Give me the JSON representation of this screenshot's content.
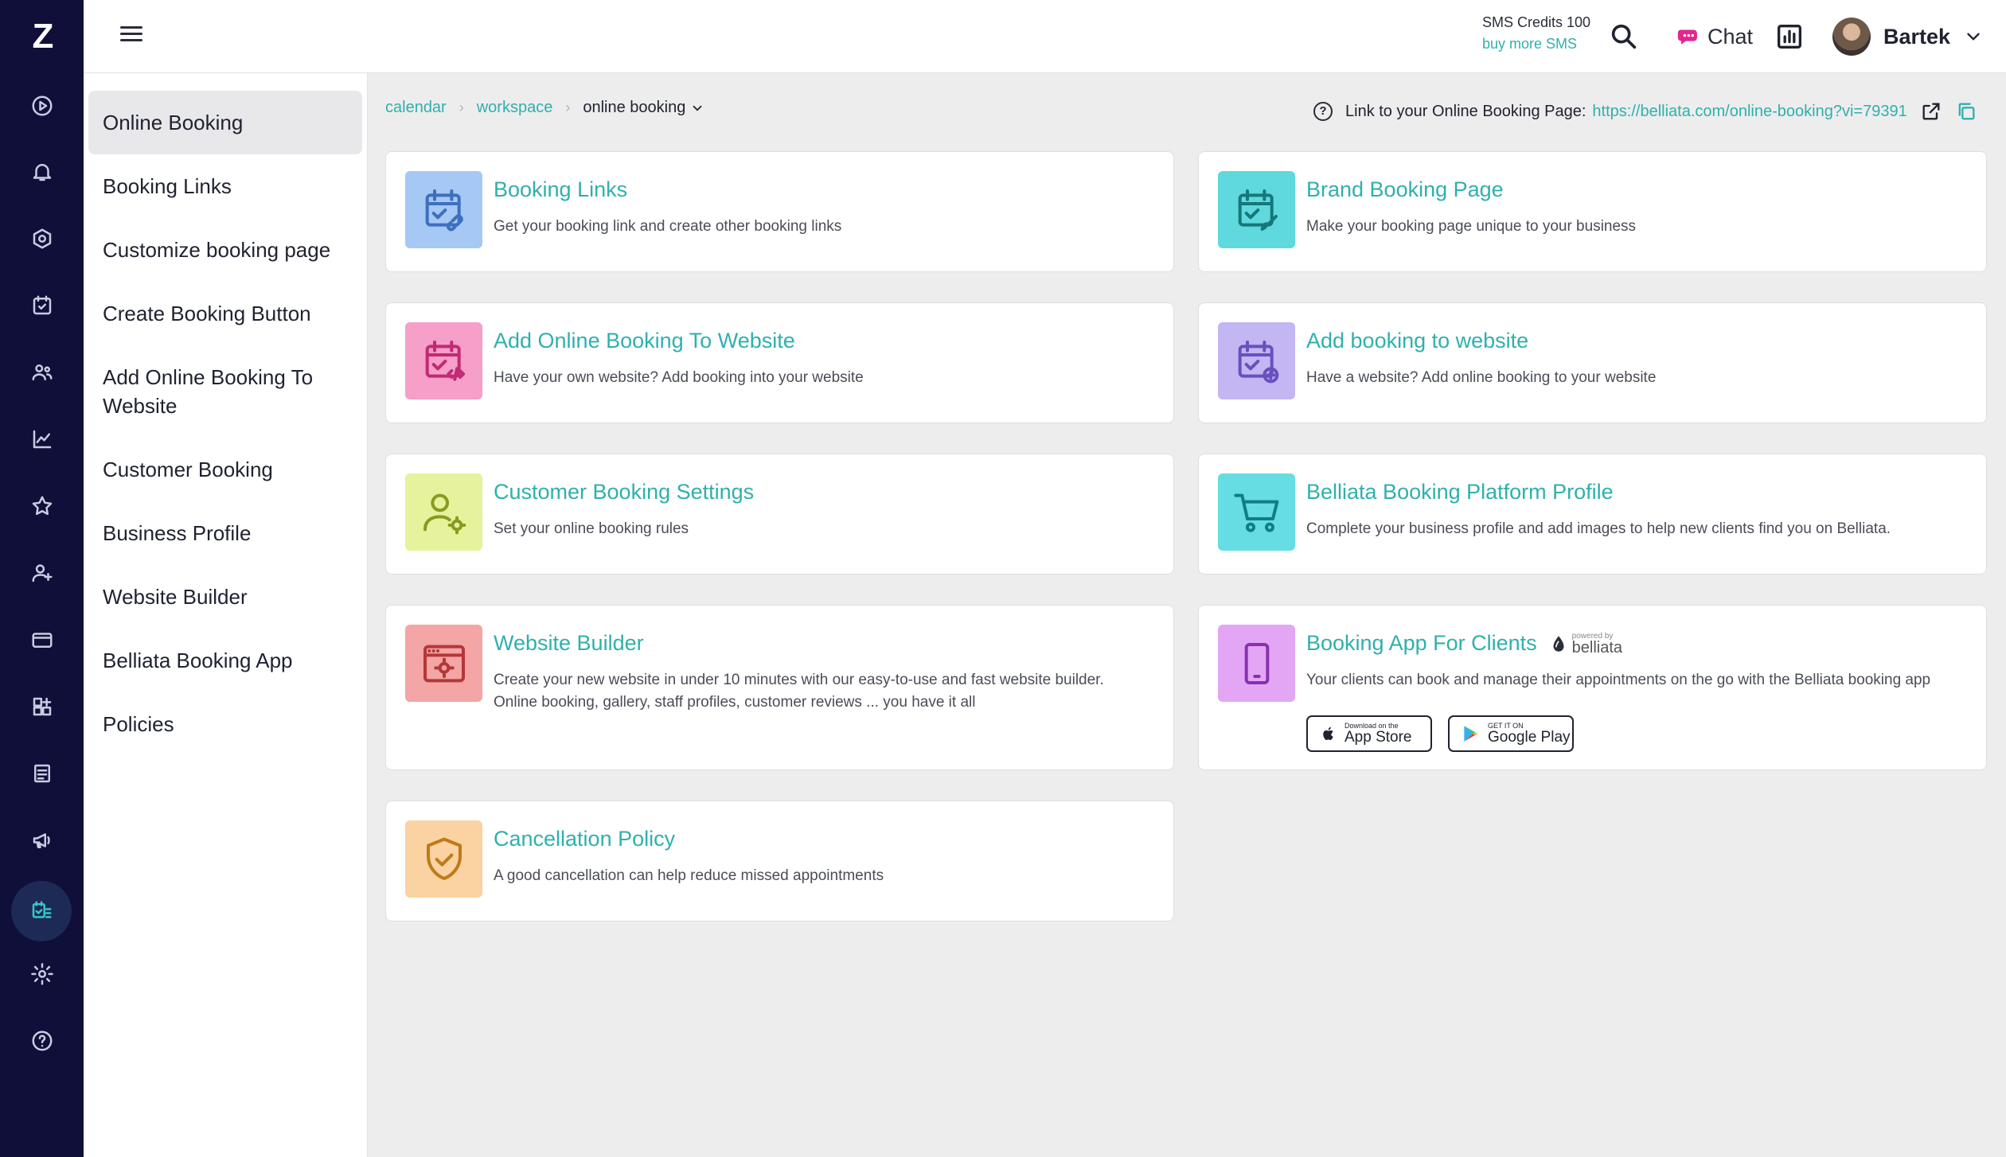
{
  "rail": {
    "logo": "Z",
    "items": [
      "play-icon",
      "bell-icon",
      "gauge-icon",
      "calendar-icon",
      "clients-icon",
      "chart-icon",
      "star-icon",
      "staff-icon",
      "card-icon",
      "apps-icon",
      "notes-icon",
      "megaphone-icon",
      "booking-icon",
      "settings-icon",
      "help-icon"
    ],
    "active": "booking-icon"
  },
  "topbar": {
    "sms_credits": "SMS Credits 100",
    "buy_sms": "buy more SMS",
    "chat_label": "Chat",
    "user_name": "Bartek"
  },
  "submenu": {
    "items": [
      {
        "label": "Online Booking",
        "active": true
      },
      {
        "label": "Booking Links"
      },
      {
        "label": "Customize booking page"
      },
      {
        "label": "Create Booking Button"
      },
      {
        "label": "Add Online Booking To Website"
      },
      {
        "label": "Customer Booking"
      },
      {
        "label": "Business Profile"
      },
      {
        "label": "Website Builder"
      },
      {
        "label": "Belliata Booking App"
      },
      {
        "label": "Policies"
      }
    ]
  },
  "breadcrumb": {
    "calendar": "calendar",
    "workspace": "workspace",
    "current": "online booking"
  },
  "linkbar": {
    "help": "?",
    "label": "Link to your Online Booking Page:",
    "url": "https://belliata.com/online-booking?vi=79391"
  },
  "cards": [
    {
      "title": "Booking Links",
      "desc": "Get your booking link and create other booking links",
      "color": "#a5c8f5",
      "icon": "calendar-link-icon"
    },
    {
      "title": "Brand Booking Page",
      "desc": "Make your booking page unique to your business",
      "color": "#5fd9dd",
      "icon": "calendar-brush-icon"
    },
    {
      "title": "Add Online Booking To Website",
      "desc": "Have your own website? Add booking into your website",
      "color": "#f59fc9",
      "icon": "calendar-code-icon"
    },
    {
      "title": "Add booking to website",
      "desc": "Have a website? Add online booking to your website",
      "color": "#c4b6f2",
      "icon": "calendar-plus-icon"
    },
    {
      "title": "Customer Booking Settings",
      "desc": "Set your online booking rules",
      "color": "#e6f29c",
      "icon": "user-gear-icon"
    },
    {
      "title": "Belliata Booking Platform Profile",
      "desc": "Complete your business profile and add images to help new clients find you on Belliata.",
      "color": "#66dce3",
      "icon": "cart-icon"
    },
    {
      "title": "Website Builder",
      "desc": "Create your new website in under 10 minutes with our easy-to-use and fast website builder. Online booking, gallery, staff profiles, customer reviews ... you have it all",
      "color": "#f4a5a5",
      "icon": "browser-gear-icon"
    },
    {
      "title": "Booking App For Clients",
      "desc": "Your clients can book and manage their appointments on the go with the Belliata booking app",
      "color": "#e3a6f5",
      "icon": "phone-icon",
      "powered_by": "powered by",
      "brand": "belliata",
      "stores": [
        {
          "small": "Download on the",
          "big": "App Store"
        },
        {
          "small": "GET IT ON",
          "big": "Google Play"
        }
      ]
    },
    {
      "title": "Cancellation Policy",
      "desc": "A good cancellation can help reduce missed appointments",
      "color": "#fbd2a1",
      "icon": "shield-check-icon"
    }
  ]
}
